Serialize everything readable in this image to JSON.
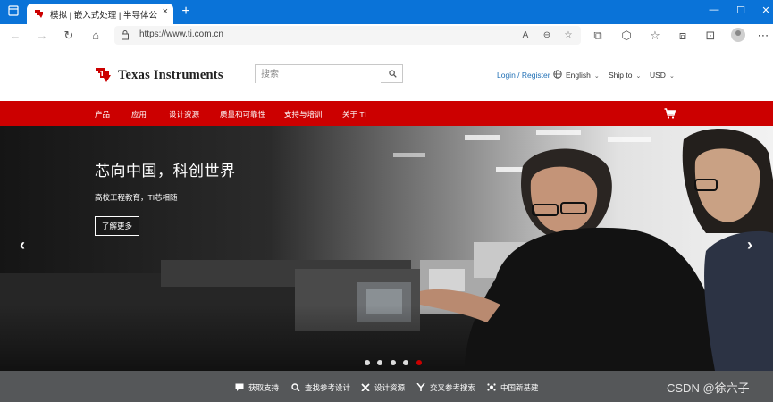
{
  "browser": {
    "tab": {
      "title": "模拟 | 嵌入式处理 | 半导体公司 | ",
      "close": "×"
    },
    "new_tab": "+",
    "window_controls": {
      "minimize": "—",
      "maximize": "☐",
      "close": "✕"
    },
    "toolbar": {
      "back": "←",
      "forward": "→",
      "reload": "↻",
      "home": "⌂",
      "url": "https://www.ti.com.cn",
      "read_aloud": "A",
      "zoom": "⊖",
      "favorite": "☆",
      "actions": [
        "⧉",
        "⬡",
        "☆",
        "⧈",
        "⊡"
      ],
      "more": "⋯"
    }
  },
  "header": {
    "logo_text": "Texas Instruments",
    "search_placeholder": "搜索",
    "login": "Login / Register",
    "language": "English",
    "ship_to": "Ship to",
    "currency": "USD"
  },
  "nav": {
    "items": [
      "产品",
      "应用",
      "设计资源",
      "质量和可靠性",
      "支持与培训",
      "关于 TI"
    ]
  },
  "hero": {
    "title": "芯向中国，科创世界",
    "subtitle": "高校工程教育，TI芯相随",
    "cta": "了解更多",
    "prev_arrow": "‹",
    "next_arrow": "›",
    "slides": 5,
    "active_slide": 5
  },
  "footer_links": [
    "获取支持",
    "查找参考设计",
    "设计资源",
    "交叉参考搜索",
    "中国新基建"
  ],
  "watermark": "CSDN @徐六子",
  "colors": {
    "brand_red": "#cc0000",
    "edge_blue": "#0a73d8",
    "footer_gray": "#555759"
  }
}
